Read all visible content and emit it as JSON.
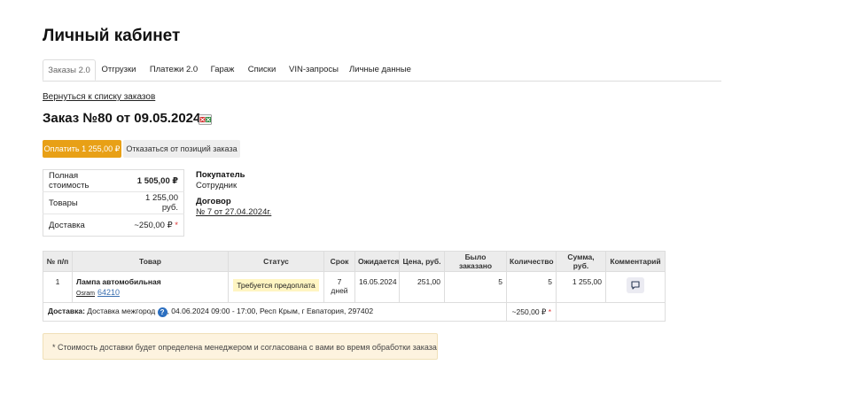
{
  "page": {
    "title": "Личный кабинет"
  },
  "tabs": [
    {
      "label": "Заказы 2.0",
      "active": true
    },
    {
      "label": "Отгрузки"
    },
    {
      "label": "Платежи 2.0"
    },
    {
      "label": "Гараж"
    },
    {
      "label": "Списки"
    },
    {
      "label": "VIN-запросы"
    },
    {
      "label": "Личные данные"
    }
  ],
  "back_link": "Вернуться к списку заказов",
  "order": {
    "title": "Заказ №80 от 09.05.2024",
    "export_icon": "excel-icon"
  },
  "actions": {
    "pay_label": "Оплатить 1 255,00 ₽",
    "refuse_label": "Отказаться от позиций заказа"
  },
  "summary": {
    "total_label": "Полная стоимость",
    "total_value": "1 505,00 ₽",
    "goods_label": "Товары",
    "goods_value": "1 255,00 руб.",
    "delivery_label": "Доставка",
    "delivery_value": "~250,00 ₽",
    "delivery_mark": "*"
  },
  "buyer": {
    "label": "Покупатель",
    "value": "Сотрудник",
    "contract_label": "Договор",
    "contract_value": "№ 7 от 27.04.2024г."
  },
  "table": {
    "headers": [
      "№ п/п",
      "Товар",
      "Статус",
      "Срок",
      "Ожидается",
      "Цена, руб.",
      "Было заказано",
      "Количество",
      "Сумма, руб.",
      "Комментарий"
    ],
    "rows": [
      {
        "num": "1",
        "name": "Лампа автомобильная",
        "brand": "Osram",
        "code": "64210",
        "status": "Требуется предоплата",
        "term": "7 дней",
        "expected": "16.05.2024",
        "price": "251,00",
        "ordered": "5",
        "qty": "5",
        "sum": "1 255,00",
        "comment_icon": "comment-icon"
      }
    ],
    "delivery": {
      "label": "Доставка:",
      "method": "Доставка межгород",
      "help_icon": "?",
      "details": ", 04.06.2024 09:00 - 17:00, Респ Крым, г Евпатория, 297402",
      "cost": "~250,00 ₽",
      "cost_mark": "*"
    }
  },
  "note": "* Стоимость доставки будет определена менеджером и согласована с вами во время обработки заказа",
  "colors": {
    "accent": "#e8a016",
    "link": "#3a6fb0",
    "status_bg": "#fff5c2",
    "note_bg": "#fdf3df",
    "required": "#dd3333"
  }
}
